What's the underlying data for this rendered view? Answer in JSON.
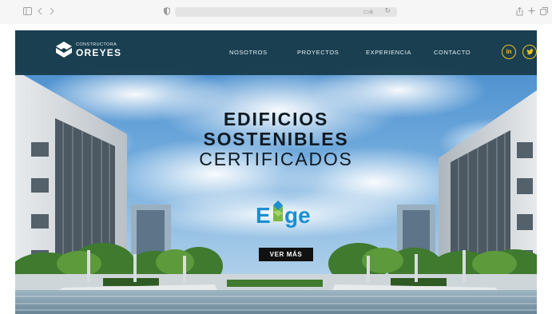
{
  "browser": {
    "sidebar_icon": "sidebar-icon",
    "back_icon": "chevron-left-icon",
    "forward_icon": "chevron-right-icon",
    "shield_icon": "privacy-shield-icon",
    "share_icon": "share-icon",
    "new_tab_icon": "plus-icon",
    "tabs_icon": "tabs-icon"
  },
  "site": {
    "logo": {
      "small": "CONSTRUCTORA",
      "big": "OREYES"
    },
    "nav": [
      {
        "label": "NOSOTROS"
      },
      {
        "label": "PROYECTOS"
      },
      {
        "label": "EXPERIENCIA"
      },
      {
        "label": "CONTACTO"
      }
    ],
    "social": [
      {
        "label": "in",
        "icon": "linkedin-icon"
      },
      {
        "label": "🐦",
        "icon": "twitter-icon"
      }
    ],
    "headline": {
      "line1": "EDIFICIOS",
      "line2": "SOSTENIBLES",
      "line3": "CERTIFICADOS"
    },
    "certification_logo": "Edge",
    "cta_label": "VER MÁS",
    "colors": {
      "nav_bg": "#163846",
      "accent": "#f2c21b",
      "edge_blue": "#1a8fd0",
      "edge_green": "#79b943"
    }
  }
}
